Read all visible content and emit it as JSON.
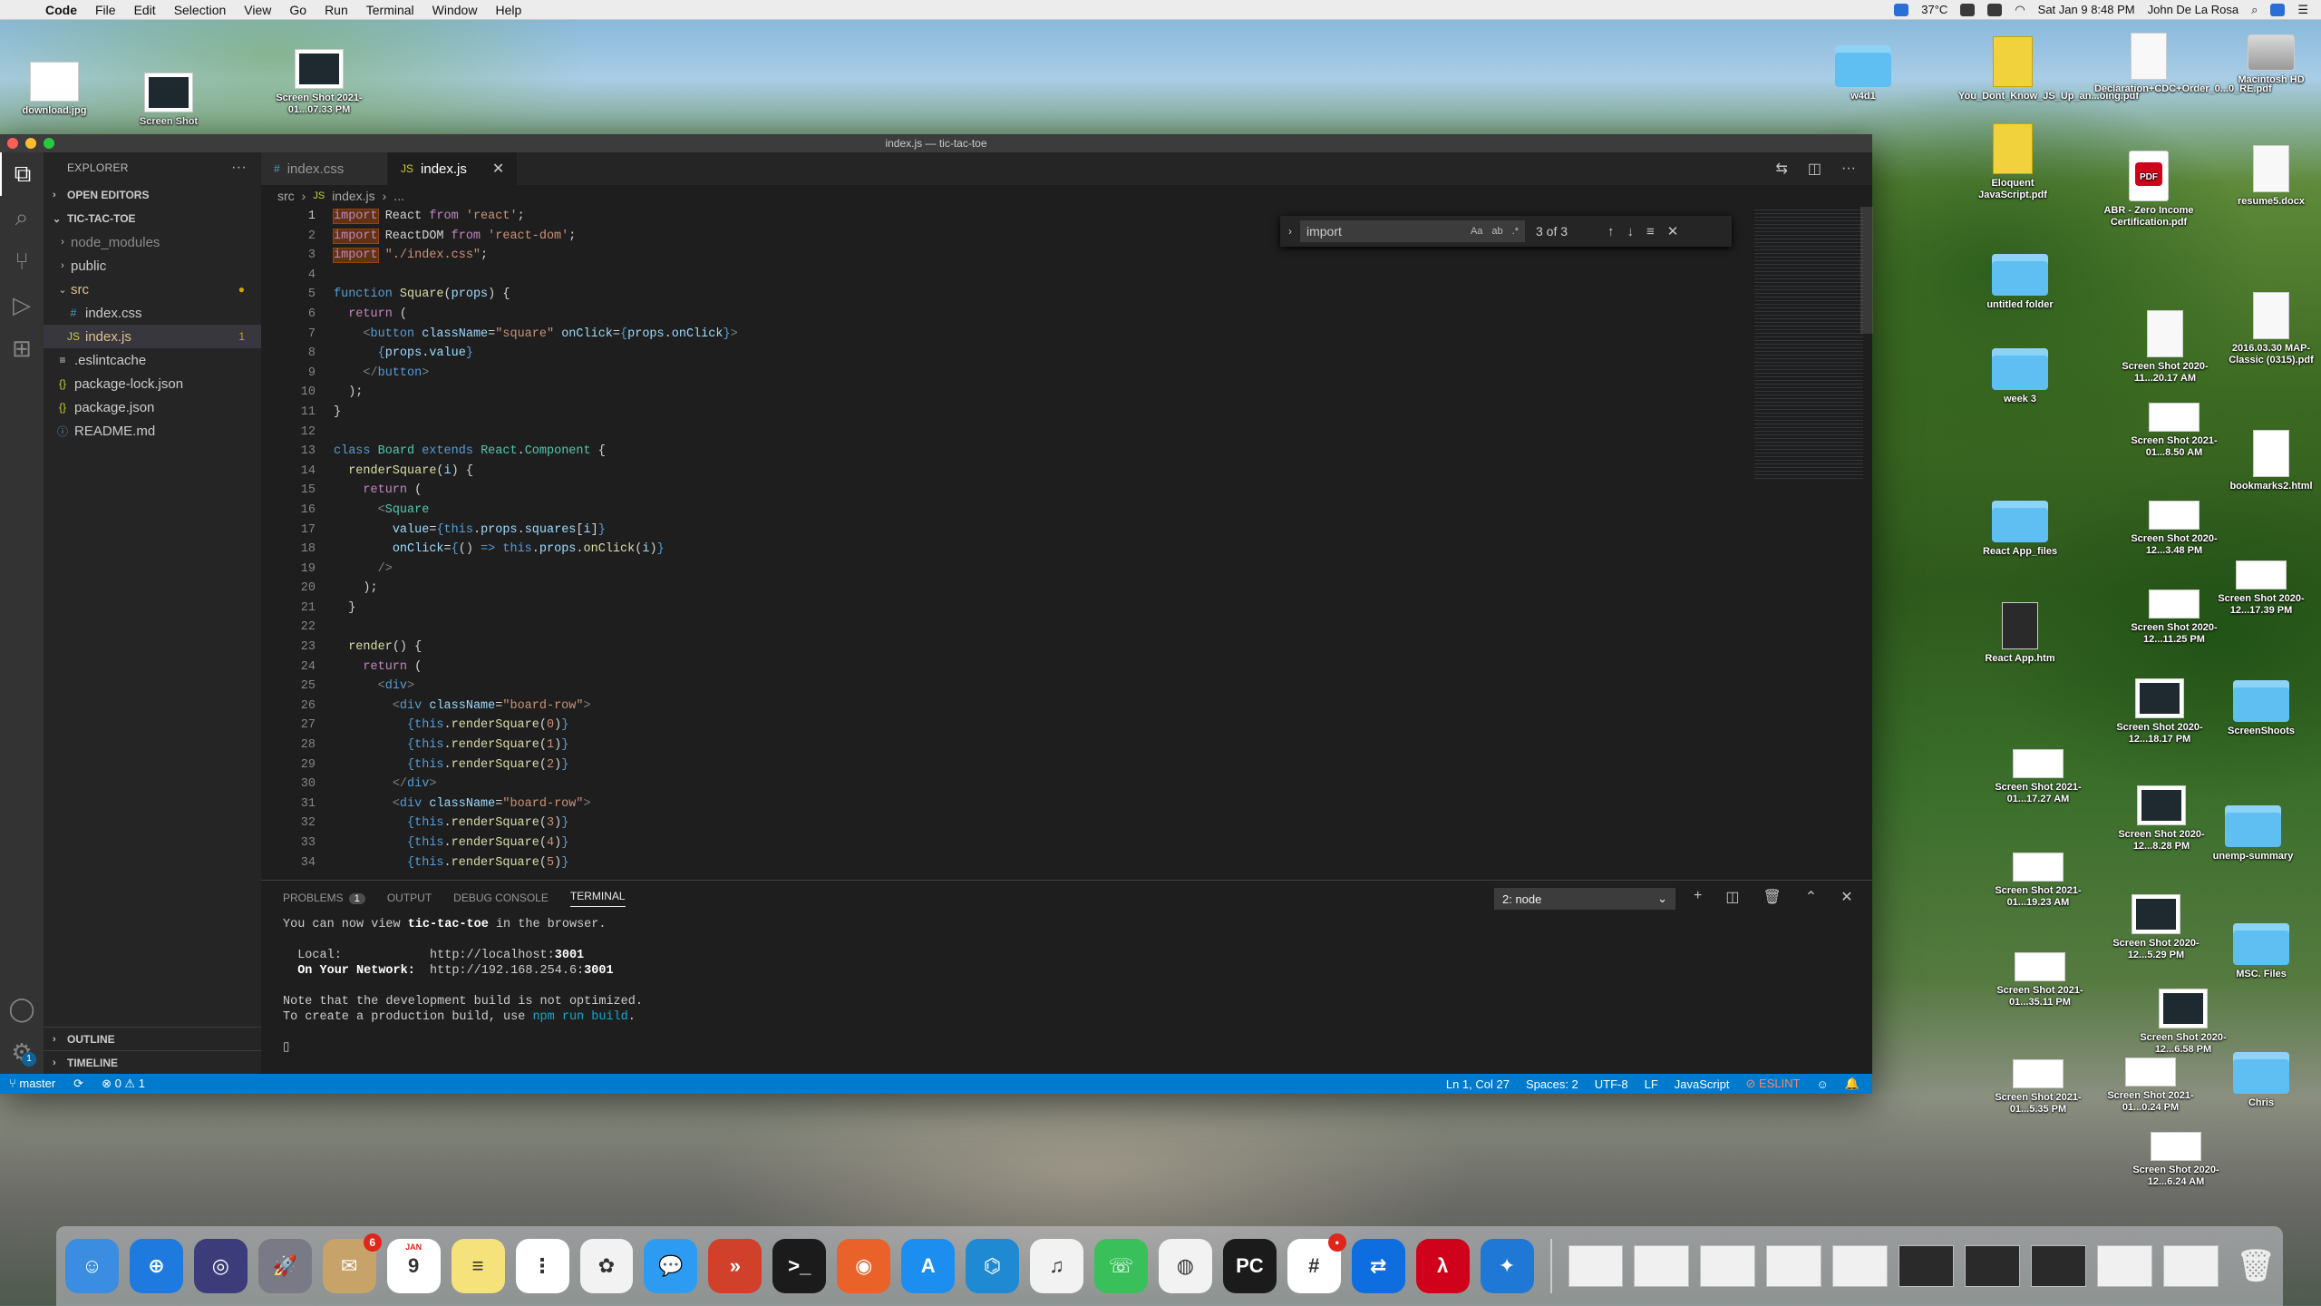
{
  "menubar": {
    "app": "Code",
    "items": [
      "File",
      "Edit",
      "Selection",
      "View",
      "Go",
      "Run",
      "Terminal",
      "Window",
      "Help"
    ],
    "temp": "37°C",
    "datetime": "Sat Jan 9  8:48 PM",
    "user": "John De La Rosa"
  },
  "desktop": {
    "left_icons": [
      {
        "label": "download.jpg"
      },
      {
        "label": "Screen Shot"
      },
      {
        "label": "Screen Shot 2021-01...07.33 PM"
      }
    ],
    "right_icons": [
      {
        "label": "w4d1",
        "kind": "folder"
      },
      {
        "label": "You_Dont_Know_JS_Up_an...oing.pdf",
        "kind": "js"
      },
      {
        "label": "Declaration+CDC+Order_0...0_RE.pdf",
        "kind": "doc"
      },
      {
        "label": "Macintosh HD",
        "kind": "hd"
      },
      {
        "label": "Eloquent JavaScript.pdf",
        "kind": "js"
      },
      {
        "label": "ABR - Zero Income Certification.pdf",
        "kind": "pdf"
      },
      {
        "label": "resume5.docx",
        "kind": "doc"
      },
      {
        "label": "untitled folder",
        "kind": "folder"
      },
      {
        "label": "Screen Shot 2020-11...20.17 AM",
        "kind": "doc"
      },
      {
        "label": "2016.03.30 MAP-Classic (0315).pdf",
        "kind": "doc"
      },
      {
        "label": "week 3",
        "kind": "folder"
      },
      {
        "label": "Screen Shot 2021-01...8.50 AM",
        "kind": "shot"
      },
      {
        "label": "bookmarks2.html",
        "kind": "html"
      },
      {
        "label": "React App_files",
        "kind": "folder"
      },
      {
        "label": "Screen Shot 2020-12...3.48 PM",
        "kind": "shot"
      },
      {
        "label": "Screen Shot 2020-12...17.39 PM",
        "kind": "shot"
      },
      {
        "label": "React App.htm",
        "kind": "htm"
      },
      {
        "label": "Screen Shot 2020-12...11.25 PM",
        "kind": "shot"
      },
      {
        "label": "Screen Shot 2020-12...18.17 PM",
        "kind": "dark"
      },
      {
        "label": "ScreenShoots",
        "kind": "folder"
      },
      {
        "label": "Screen Shot 2021-01...17.27 AM",
        "kind": "shot"
      },
      {
        "label": "Screen Shot 2020-12...8.28 PM",
        "kind": "dark"
      },
      {
        "label": "unemp-summary",
        "kind": "folder"
      },
      {
        "label": "Screen Shot 2021-01...19.23 AM",
        "kind": "shot"
      },
      {
        "label": "Screen Shot 2020-12...5.29 PM",
        "kind": "dark"
      },
      {
        "label": "MSC. Files",
        "kind": "folder"
      },
      {
        "label": "Screen Shot 2021-01...35.11 PM",
        "kind": "shot"
      },
      {
        "label": "Screen Shot 2020-12...6.58 PM",
        "kind": "dark"
      },
      {
        "label": "Screen Shot 2021-01...5.35 PM",
        "kind": "shot"
      },
      {
        "label": "Screen Shot 2021-01...0.24 PM",
        "kind": "shot"
      },
      {
        "label": "Chris",
        "kind": "folder"
      },
      {
        "label": "Screen Shot 2020-12...6.24 AM",
        "kind": "shot"
      }
    ]
  },
  "window": {
    "title": "index.js — tic-tac-toe"
  },
  "explorer": {
    "header": "EXPLORER",
    "open_editors": "OPEN EDITORS",
    "project": "TIC-TAC-TOE",
    "items": [
      {
        "label": "node_modules",
        "type": "folder",
        "depth": 1,
        "chev": "›",
        "color": "#8b8b8b"
      },
      {
        "label": "public",
        "type": "folder",
        "depth": 1,
        "chev": "›",
        "color": "#cccccc"
      },
      {
        "label": "src",
        "type": "folder",
        "depth": 1,
        "chev": "⌄",
        "color": "#e2c08d",
        "badge": "●"
      },
      {
        "label": "index.css",
        "type": "file",
        "depth": 2,
        "icon": "#",
        "iconColor": "#519aba",
        "color": "#cccccc"
      },
      {
        "label": "index.js",
        "type": "file",
        "depth": 2,
        "icon": "JS",
        "iconColor": "#cbcb41",
        "color": "#e2c08d",
        "badge": "1",
        "selected": true
      },
      {
        "label": ".eslintcache",
        "type": "file",
        "depth": 1,
        "icon": "≡",
        "iconColor": "#cccccc",
        "color": "#cccccc"
      },
      {
        "label": "package-lock.json",
        "type": "file",
        "depth": 1,
        "icon": "{}",
        "iconColor": "#cbcb41",
        "color": "#cccccc"
      },
      {
        "label": "package.json",
        "type": "file",
        "depth": 1,
        "icon": "{}",
        "iconColor": "#cbcb41",
        "color": "#cccccc"
      },
      {
        "label": "README.md",
        "type": "file",
        "depth": 1,
        "icon": "ⓘ",
        "iconColor": "#519aba",
        "color": "#cccccc"
      }
    ],
    "outline": "OUTLINE",
    "timeline": "TIMELINE"
  },
  "tabs": [
    {
      "label": "index.css",
      "icon": "#",
      "active": false
    },
    {
      "label": "index.js",
      "icon": "JS",
      "active": true
    }
  ],
  "breadcrumb": {
    "folder": "src",
    "file": "index.js",
    "rest": "..."
  },
  "find": {
    "query": "import",
    "count": "3 of 3",
    "opt1": "Aa",
    "opt2": "ab",
    "opt3": ".*"
  },
  "code_lines": [
    [
      [
        "import",
        "kw2 hl"
      ],
      [
        " React ",
        ""
      ],
      [
        "from",
        "kw2"
      ],
      [
        " ",
        ""
      ],
      [
        "'react'",
        "str"
      ],
      [
        ";",
        ""
      ]
    ],
    [
      [
        "import",
        "kw2 hl"
      ],
      [
        " ReactDOM ",
        ""
      ],
      [
        "from",
        "kw2"
      ],
      [
        " ",
        ""
      ],
      [
        "'react-dom'",
        "str"
      ],
      [
        ";",
        ""
      ]
    ],
    [
      [
        "import",
        "kw2 hl"
      ],
      [
        " ",
        ""
      ],
      [
        "\"./index.css\"",
        "str"
      ],
      [
        ";",
        ""
      ]
    ],
    [],
    [
      [
        "function",
        "kw"
      ],
      [
        " ",
        ""
      ],
      [
        "Square",
        "fn"
      ],
      [
        "(",
        ""
      ],
      [
        "props",
        "attr"
      ],
      [
        ") {",
        ""
      ]
    ],
    [
      [
        "  ",
        ""
      ],
      [
        "return",
        "kw2"
      ],
      [
        " (",
        ""
      ]
    ],
    [
      [
        "    ",
        ""
      ],
      [
        "<",
        "br"
      ],
      [
        "button",
        "tag"
      ],
      [
        " ",
        ""
      ],
      [
        "className",
        "attr"
      ],
      [
        "=",
        ""
      ],
      [
        "\"square\"",
        "str"
      ],
      [
        " ",
        ""
      ],
      [
        "onClick",
        "attr"
      ],
      [
        "=",
        ""
      ],
      [
        "{",
        "kw"
      ],
      [
        "props",
        "attr"
      ],
      [
        ".",
        ""
      ],
      [
        "onClick",
        "attr"
      ],
      [
        "}",
        "kw"
      ],
      [
        ">",
        "br"
      ]
    ],
    [
      [
        "      ",
        ""
      ],
      [
        "{",
        "kw"
      ],
      [
        "props",
        "attr"
      ],
      [
        ".",
        ""
      ],
      [
        "value",
        "attr"
      ],
      [
        "}",
        "kw"
      ]
    ],
    [
      [
        "    ",
        ""
      ],
      [
        "</",
        "br"
      ],
      [
        "button",
        "tag"
      ],
      [
        ">",
        "br"
      ]
    ],
    [
      [
        "  );",
        ""
      ]
    ],
    [
      [
        "}",
        ""
      ]
    ],
    [],
    [
      [
        "class",
        "kw"
      ],
      [
        " ",
        ""
      ],
      [
        "Board",
        "cls"
      ],
      [
        " ",
        ""
      ],
      [
        "extends",
        "kw"
      ],
      [
        " ",
        ""
      ],
      [
        "React",
        "cls"
      ],
      [
        ".",
        ""
      ],
      [
        "Component",
        "cls"
      ],
      [
        " {",
        ""
      ]
    ],
    [
      [
        "  ",
        ""
      ],
      [
        "renderSquare",
        "fn"
      ],
      [
        "(",
        ""
      ],
      [
        "i",
        "attr"
      ],
      [
        ") {",
        ""
      ]
    ],
    [
      [
        "    ",
        ""
      ],
      [
        "return",
        "kw2"
      ],
      [
        " (",
        ""
      ]
    ],
    [
      [
        "      ",
        ""
      ],
      [
        "<",
        "br"
      ],
      [
        "Square",
        "cls"
      ]
    ],
    [
      [
        "        ",
        ""
      ],
      [
        "value",
        "attr"
      ],
      [
        "=",
        ""
      ],
      [
        "{",
        "kw"
      ],
      [
        "this",
        "kw"
      ],
      [
        ".",
        ""
      ],
      [
        "props",
        "attr"
      ],
      [
        ".",
        ""
      ],
      [
        "squares",
        "attr"
      ],
      [
        "[",
        ""
      ],
      [
        "i",
        "attr"
      ],
      [
        "]",
        ""
      ],
      [
        "}",
        "kw"
      ]
    ],
    [
      [
        "        ",
        ""
      ],
      [
        "onClick",
        "attr"
      ],
      [
        "=",
        ""
      ],
      [
        "{",
        "kw"
      ],
      [
        "() ",
        ""
      ],
      [
        "=>",
        "kw"
      ],
      [
        " ",
        ""
      ],
      [
        "this",
        "kw"
      ],
      [
        ".",
        ""
      ],
      [
        "props",
        "attr"
      ],
      [
        ".",
        ""
      ],
      [
        "onClick",
        "fn"
      ],
      [
        "(",
        ""
      ],
      [
        "i",
        "attr"
      ],
      [
        ")",
        ""
      ],
      [
        "}",
        "kw"
      ]
    ],
    [
      [
        "      ",
        ""
      ],
      [
        "/>",
        "br"
      ]
    ],
    [
      [
        "    );",
        ""
      ]
    ],
    [
      [
        "  }",
        ""
      ]
    ],
    [],
    [
      [
        "  ",
        ""
      ],
      [
        "render",
        "fn"
      ],
      [
        "() {",
        ""
      ]
    ],
    [
      [
        "    ",
        ""
      ],
      [
        "return",
        "kw2"
      ],
      [
        " (",
        ""
      ]
    ],
    [
      [
        "      ",
        ""
      ],
      [
        "<",
        "br"
      ],
      [
        "div",
        "tag"
      ],
      [
        ">",
        "br"
      ]
    ],
    [
      [
        "        ",
        ""
      ],
      [
        "<",
        "br"
      ],
      [
        "div",
        "tag"
      ],
      [
        " ",
        ""
      ],
      [
        "className",
        "attr"
      ],
      [
        "=",
        ""
      ],
      [
        "\"board-row\"",
        "str"
      ],
      [
        ">",
        "br"
      ]
    ],
    [
      [
        "          ",
        ""
      ],
      [
        "{",
        "kw"
      ],
      [
        "this",
        "kw"
      ],
      [
        ".",
        ""
      ],
      [
        "renderSquare",
        "fn"
      ],
      [
        "(",
        ""
      ],
      [
        "0",
        "str"
      ],
      [
        ")",
        ""
      ],
      [
        "}",
        "kw"
      ]
    ],
    [
      [
        "          ",
        ""
      ],
      [
        "{",
        "kw"
      ],
      [
        "this",
        "kw"
      ],
      [
        ".",
        ""
      ],
      [
        "renderSquare",
        "fn"
      ],
      [
        "(",
        ""
      ],
      [
        "1",
        "str"
      ],
      [
        ")",
        ""
      ],
      [
        "}",
        "kw"
      ]
    ],
    [
      [
        "          ",
        ""
      ],
      [
        "{",
        "kw"
      ],
      [
        "this",
        "kw"
      ],
      [
        ".",
        ""
      ],
      [
        "renderSquare",
        "fn"
      ],
      [
        "(",
        ""
      ],
      [
        "2",
        "str"
      ],
      [
        ")",
        ""
      ],
      [
        "}",
        "kw"
      ]
    ],
    [
      [
        "        ",
        ""
      ],
      [
        "</",
        "br"
      ],
      [
        "div",
        "tag"
      ],
      [
        ">",
        "br"
      ]
    ],
    [
      [
        "        ",
        ""
      ],
      [
        "<",
        "br"
      ],
      [
        "div",
        "tag"
      ],
      [
        " ",
        ""
      ],
      [
        "className",
        "attr"
      ],
      [
        "=",
        ""
      ],
      [
        "\"board-row\"",
        "str"
      ],
      [
        ">",
        "br"
      ]
    ],
    [
      [
        "          ",
        ""
      ],
      [
        "{",
        "kw"
      ],
      [
        "this",
        "kw"
      ],
      [
        ".",
        ""
      ],
      [
        "renderSquare",
        "fn"
      ],
      [
        "(",
        ""
      ],
      [
        "3",
        "str"
      ],
      [
        ")",
        ""
      ],
      [
        "}",
        "kw"
      ]
    ],
    [
      [
        "          ",
        ""
      ],
      [
        "{",
        "kw"
      ],
      [
        "this",
        "kw"
      ],
      [
        ".",
        ""
      ],
      [
        "renderSquare",
        "fn"
      ],
      [
        "(",
        ""
      ],
      [
        "4",
        "str"
      ],
      [
        ")",
        ""
      ],
      [
        "}",
        "kw"
      ]
    ],
    [
      [
        "          ",
        ""
      ],
      [
        "{",
        "kw"
      ],
      [
        "this",
        "kw"
      ],
      [
        ".",
        ""
      ],
      [
        "renderSquare",
        "fn"
      ],
      [
        "(",
        ""
      ],
      [
        "5",
        "str"
      ],
      [
        ")",
        ""
      ],
      [
        "}",
        "kw"
      ]
    ]
  ],
  "panel": {
    "tabs": [
      {
        "label": "PROBLEMS",
        "badge": "1"
      },
      {
        "label": "OUTPUT"
      },
      {
        "label": "DEBUG CONSOLE"
      },
      {
        "label": "TERMINAL",
        "active": true
      }
    ],
    "terminal_select": "2: node",
    "terminal_lines": [
      [
        [
          "You can now view ",
          ""
        ],
        [
          "tic-tac-toe",
          "b"
        ],
        [
          " in the browser.",
          ""
        ]
      ],
      [],
      [
        [
          "  Local:            http://localhost:",
          ""
        ],
        [
          "3001",
          "b"
        ]
      ],
      [
        [
          "  ",
          ""
        ],
        [
          "On Your Network:",
          "b"
        ],
        [
          "  http://192.168.254.6:",
          ""
        ],
        [
          "3001",
          "b"
        ]
      ],
      [],
      [
        [
          "Note that the development build is not optimized.",
          ""
        ]
      ],
      [
        [
          "To create a production build, use ",
          ""
        ],
        [
          "npm run build",
          "c"
        ],
        [
          ".",
          ""
        ]
      ],
      [],
      [
        [
          "▯",
          ""
        ]
      ]
    ]
  },
  "status": {
    "branch": "master",
    "errors": "⊗ 0",
    "warnings": "⚠ 1",
    "position": "Ln 1, Col 27",
    "spaces": "Spaces: 2",
    "encoding": "UTF-8",
    "eol": "LF",
    "language": "JavaScript",
    "eslint": "⊘ ESLINT"
  },
  "dock": {
    "apps": [
      {
        "name": "finder",
        "color": "#3a8de0",
        "glyph": "☺"
      },
      {
        "name": "safari",
        "color": "#1f7ae0",
        "glyph": "⊕"
      },
      {
        "name": "siri",
        "color": "#3c3c7a",
        "glyph": "◎"
      },
      {
        "name": "launchpad",
        "color": "#7a7a86",
        "glyph": "🚀"
      },
      {
        "name": "mail-stamp",
        "color": "#c7a36a",
        "glyph": "✉",
        "badge": "6"
      },
      {
        "name": "calendar",
        "color": "#ffffff",
        "glyph": "9",
        "month": "JAN"
      },
      {
        "name": "notes",
        "color": "#f6e27a",
        "glyph": "≡"
      },
      {
        "name": "reminders",
        "color": "#ffffff",
        "glyph": "⋮"
      },
      {
        "name": "photos",
        "color": "#f2f2f2",
        "glyph": "✿"
      },
      {
        "name": "messages",
        "color": "#2e9bf2",
        "glyph": "💬"
      },
      {
        "name": "remote-desktop",
        "color": "#d0402b",
        "glyph": "»"
      },
      {
        "name": "terminal",
        "color": "#1b1b1b",
        "glyph": ">_"
      },
      {
        "name": "firefox",
        "color": "#e8622a",
        "glyph": "◉"
      },
      {
        "name": "app-store",
        "color": "#1c8ef0",
        "glyph": "A"
      },
      {
        "name": "vscode",
        "color": "#1f8ad2",
        "glyph": "⌬"
      },
      {
        "name": "music",
        "color": "#f2f2f2",
        "glyph": "♫"
      },
      {
        "name": "facetime",
        "color": "#3ac05a",
        "glyph": "☏"
      },
      {
        "name": "chrome",
        "color": "#f2f2f2",
        "glyph": "◍"
      },
      {
        "name": "pycharm",
        "color": "#1b1b1b",
        "glyph": "PC"
      },
      {
        "name": "slack",
        "color": "#ffffff",
        "glyph": "#",
        "badge": "•"
      },
      {
        "name": "teamviewer",
        "color": "#0e6ee0",
        "glyph": "⇄"
      },
      {
        "name": "acrobat",
        "color": "#d0021b",
        "glyph": "λ"
      },
      {
        "name": "mail-bird",
        "color": "#1f77d6",
        "glyph": "✦"
      }
    ]
  }
}
